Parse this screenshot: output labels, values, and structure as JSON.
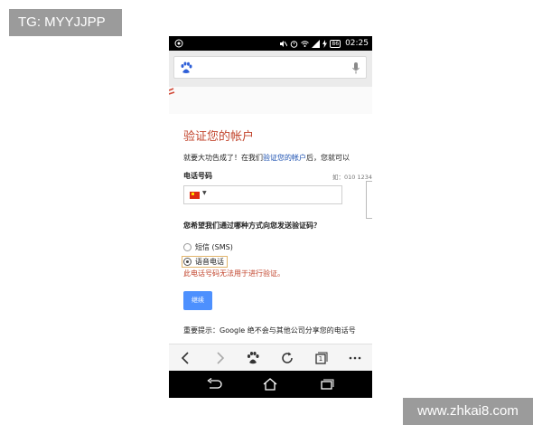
{
  "watermarks": {
    "top_left": "TG: MYYJJPP",
    "bottom_right": "www.zhkai8.com"
  },
  "statusbar": {
    "battery": "86",
    "time": "02:25",
    "icons": [
      "camera-icon",
      "mute-icon",
      "alarm-icon",
      "wifi-icon",
      "signal-icon",
      "charging-icon"
    ]
  },
  "search": {
    "value": "",
    "icons": [
      "baidu-paw-icon",
      "microphone-icon"
    ]
  },
  "page": {
    "title": "验证您的帐户",
    "desc_prefix": "就要大功告成了！在我们",
    "desc_link": "验证您的帐户",
    "desc_suffix": "后，您就可以",
    "phone_label": "电话号码",
    "phone_example": "如：010 1234",
    "phone_value": "",
    "question": "您希望我们通过哪种方式向您发送验证码？",
    "option_sms": "短信 (SMS)",
    "option_voice": "语音电话",
    "selected_option": "语音电话",
    "error": "此电话号码无法用于进行验证。",
    "continue_label": "继续",
    "notice": "重要提示：Google 绝不会与其他公司分享您的电话号"
  },
  "browser_toolbar": {
    "tab_count": "1",
    "icons": [
      "back-icon",
      "forward-icon",
      "baidu-paw-icon",
      "refresh-icon",
      "tabs-icon",
      "more-icon"
    ]
  },
  "system_nav": {
    "icons": [
      "system-back-icon",
      "home-icon",
      "recent-apps-icon"
    ]
  },
  "colors": {
    "title_red": "#c2452d",
    "link_blue": "#1a4fb0",
    "button_blue": "#4d90fe",
    "status_black": "#000000"
  }
}
